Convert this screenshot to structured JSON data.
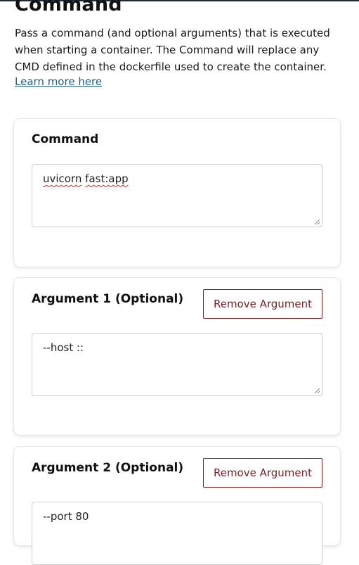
{
  "section": {
    "title": "Command",
    "description": "Pass a command (and optional arguments) that is executed when starting a container. The Command will replace any CMD defined in the dockerfile used to create the container.",
    "learn_more": "Learn more here"
  },
  "command_card": {
    "label": "Command",
    "value_word1": "uvicorn",
    "value_space": " ",
    "value_word2": "fast:app"
  },
  "arguments": [
    {
      "label": "Argument 1 (Optional)",
      "remove_label": "Remove Argument",
      "value": "--host ::"
    },
    {
      "label": "Argument 2 (Optional)",
      "remove_label": "Remove Argument",
      "value": "--port 80"
    }
  ],
  "colors": {
    "link": "#1f5f88",
    "remove_button": "#7a1f24",
    "spellcheck_underline": "#dd2222"
  },
  "icons": [
    "resize-grip-icon"
  ]
}
